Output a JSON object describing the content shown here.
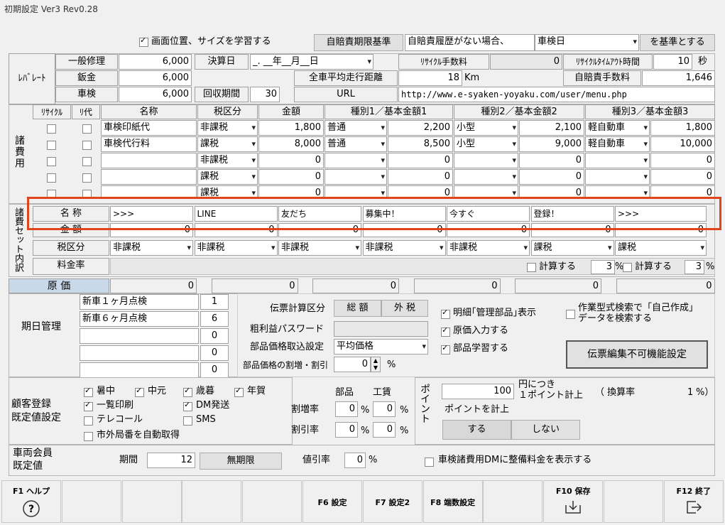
{
  "window": {
    "title": "初期設定 Ver3 Rev0.28"
  },
  "top": {
    "learn_label": "画面位置、サイズを学習する",
    "base_btn": "自賠責期限基準",
    "no_history": "自賠責履歴がない場合、",
    "select_value": "車検日",
    "suffix": "を基準とする"
  },
  "rate": {
    "group": "ﾚﾊﾞﾚｰﾄ",
    "rows": [
      {
        "label": "一般修理",
        "value": "6,000"
      },
      {
        "label": "鈑金",
        "value": "6,000"
      },
      {
        "label": "車検",
        "value": "6,000"
      }
    ],
    "settle_label": "決算日",
    "settle_value": "_. __年__月__日",
    "collect_label": "回収期間",
    "collect_value": "30",
    "recycle_fee_label": "ﾘｻｲｸﾙ手数料",
    "recycle_fee_value": "0",
    "timeout_label": "ﾘｻｲｸﾙﾀｲﾑｱｳﾄ時間",
    "timeout_value": "10",
    "timeout_unit": "秒",
    "distance_label": "全車平均走行距離",
    "distance_value": "18",
    "distance_unit": "Km",
    "insurance_fee_label": "自賠責手数料",
    "insurance_fee_value": "1,646",
    "url_label": "URL",
    "url_value": "http://www.e-syaken-yoyaku.com/user/menu.php"
  },
  "fees": {
    "group": "諸費用",
    "headers": [
      "ﾘｻｲｸﾙ",
      "ﾘ代",
      "名称",
      "税区分",
      "金額",
      "種別1／基本金額1",
      "種別2／基本金額2",
      "種別3／基本金額3"
    ],
    "rows": [
      {
        "name": "車検印紙代",
        "tax": "非課税",
        "amount": "1,800",
        "t1": "普通",
        "a1": "2,200",
        "t2": "小型",
        "a2": "2,100",
        "t3": "軽自動車",
        "a3": "1,800"
      },
      {
        "name": "車検代行料",
        "tax": "課税",
        "amount": "8,000",
        "t1": "普通",
        "a1": "8,500",
        "t2": "小型",
        "a2": "9,000",
        "t3": "軽自動車",
        "a3": "10,000"
      },
      {
        "name": "",
        "tax": "非課税",
        "amount": "0",
        "t1": "",
        "a1": "0",
        "t2": "",
        "a2": "0",
        "t3": "",
        "a3": "0"
      },
      {
        "name": "",
        "tax": "課税",
        "amount": "0",
        "t1": "",
        "a1": "0",
        "t2": "",
        "a2": "0",
        "t3": "",
        "a3": "0"
      },
      {
        "name": "",
        "tax": "課税",
        "amount": "0",
        "t1": "",
        "a1": "0",
        "t2": "",
        "a2": "0",
        "t3": "",
        "a3": "0"
      }
    ]
  },
  "set": {
    "group": "諸費セット内訳",
    "name_label": "名 称",
    "amount_label": "金 額",
    "tax_label": "税区分",
    "rate_label": "料金率",
    "names": [
      ">>>",
      "LINE",
      "友だち",
      "募集中！",
      "今すぐ",
      "登録！",
      ">>>"
    ],
    "amounts": [
      "0",
      "0",
      "0",
      "0",
      "0",
      "0",
      "0"
    ],
    "taxes": [
      "非課税",
      "非課税",
      "非課税",
      "非課税",
      "非課税",
      "課税",
      "課税"
    ],
    "calc_label": "計算する",
    "calc1_pct": "3",
    "calc2_pct": "3",
    "pct": "%"
  },
  "cost": {
    "label": "原 価",
    "values": [
      "0",
      "0",
      "0",
      "0",
      "0",
      "0"
    ]
  },
  "schedule": {
    "group": "期日管理",
    "items": [
      {
        "name": "新車１ヶ月点検",
        "value": "1"
      },
      {
        "name": "新車６ヶ月点検",
        "value": "6"
      },
      {
        "name": "",
        "value": "0"
      },
      {
        "name": "",
        "value": "0"
      },
      {
        "name": "",
        "value": "0"
      }
    ],
    "slip_label": "伝票計算区分",
    "slip_total": "総 額",
    "slip_tax": "外 税",
    "pw_label": "粗利益パスワード",
    "parts_price_label": "部品価格取込設定",
    "parts_price_value": "平均価格",
    "parts_ratio_label": "部品価格の割増・割引",
    "parts_ratio_value": "0",
    "pct": "%",
    "chk_detail": "明細｢管理部品｣表示",
    "chk_cost": "原価入力する",
    "chk_learn": "部品学習する",
    "chk_search": "作業型式検索で「自己作成」データを検索する",
    "slip_btn": "伝票編集不可機能設定"
  },
  "customer": {
    "group": "顧客登録\n既定値設定",
    "checks": [
      {
        "label": "暑中",
        "on": true
      },
      {
        "label": "中元",
        "on": true
      },
      {
        "label": "歳暮",
        "on": true
      },
      {
        "label": "年賀",
        "on": true
      },
      {
        "label": "一覧印刷",
        "on": true
      },
      {
        "label": "DM発送",
        "on": true
      },
      {
        "label": "テレコール",
        "on": false
      },
      {
        "label": "SMS",
        "on": false
      }
    ],
    "auto_label": "市外局番を自動取得",
    "parts": "部品",
    "labor": "工賃",
    "markup": "割増率",
    "discount": "割引率",
    "zero": "0",
    "pct": "%"
  },
  "point": {
    "group": "ポイント",
    "yen_value": "100",
    "per_text": "円につき",
    "one_text": "１ポイント計上",
    "rate_label": "（ 換算率",
    "rate_value": "1",
    "rate_end": "%）",
    "calc_label": "ポイントを計上",
    "yes": "する",
    "no": "しない"
  },
  "member": {
    "group": "車両会員\n既定値",
    "period_label": "期間",
    "period_value": "12",
    "unlimited": "無期限",
    "discount_label": "値引率",
    "discount_value": "0",
    "pct": "%",
    "dm_label": "車検諸費用DMに整備料金を表示する"
  },
  "fkeys": [
    {
      "label": "F1 ヘルプ",
      "icon": "help-icon"
    },
    {
      "label": "",
      "icon": ""
    },
    {
      "label": "",
      "icon": ""
    },
    {
      "label": "",
      "icon": ""
    },
    {
      "label": "",
      "icon": ""
    },
    {
      "label": "F6 設定",
      "icon": ""
    },
    {
      "label": "F7 設定2",
      "icon": ""
    },
    {
      "label": "F8 端数設定",
      "icon": ""
    },
    {
      "label": "",
      "icon": ""
    },
    {
      "label": "F10 保存",
      "icon": "save-icon"
    },
    {
      "label": "",
      "icon": ""
    },
    {
      "label": "F12 終了",
      "icon": "exit-icon"
    }
  ],
  "colors": {
    "highlight": "#e0441c",
    "cost_header": "#c9d9ea"
  }
}
